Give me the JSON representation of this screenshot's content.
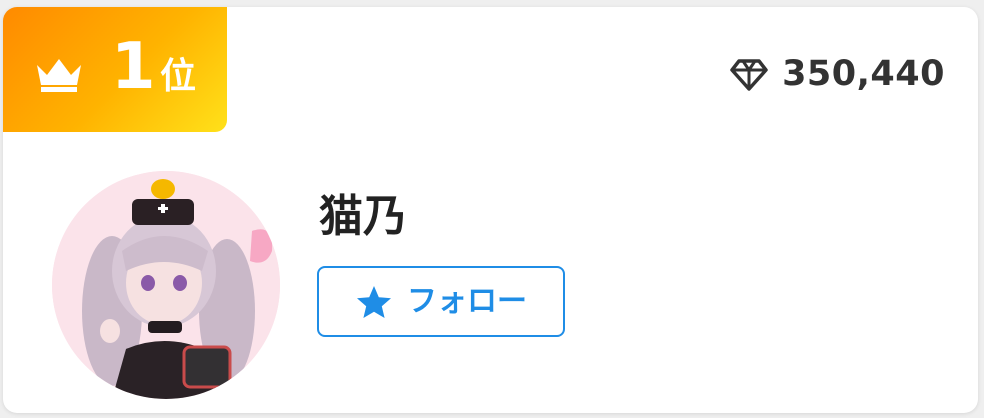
{
  "rank": {
    "number": "1",
    "suffix": "位",
    "icon": "crown-icon"
  },
  "score": {
    "icon": "diamond-icon",
    "value": "350,440"
  },
  "user": {
    "name": "猫乃",
    "avatar": "user-avatar"
  },
  "follow_button": {
    "icon": "star-icon",
    "label": "フォロー"
  },
  "colors": {
    "badge_start": "#ff8a00",
    "badge_end": "#ffe11a",
    "accent_blue": "#1f8de6",
    "text_dark": "#333333"
  }
}
